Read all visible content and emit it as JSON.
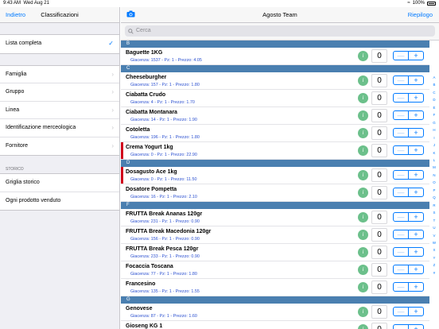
{
  "status": {
    "time": "9:43 AM",
    "date": "Wed Aug 21",
    "battery": "100%"
  },
  "left": {
    "back_label": "Indietro",
    "title": "Classificazioni",
    "complete_list": "Lista completa",
    "filters": [
      "Famiglia",
      "Gruppo",
      "Linea",
      "Identificazione merceologica",
      "Fornitore"
    ],
    "history_header": "STORICO",
    "history": [
      "Griglia storico",
      "Ogni prodotto venduto"
    ]
  },
  "main": {
    "title": "Agosto Team",
    "summary_label": "Riepilogo",
    "search_placeholder": "Cerca",
    "minus": "—",
    "plus": "+",
    "info": "i"
  },
  "sections": [
    {
      "letter": "B",
      "items": [
        {
          "name": "Baguette 1KG",
          "sub": "Giacenza: 1537 - Pz: 1 - Prezzo: 4.05",
          "qty": "0",
          "flag": false
        }
      ]
    },
    {
      "letter": "C",
      "items": [
        {
          "name": "Cheeseburgher",
          "sub": "Giacenza: 157 - Pz: 1 - Prezzo: 1.80",
          "qty": "0",
          "flag": false
        },
        {
          "name": "Ciabatta Crudo",
          "sub": "Giacenza: 4 - Pz: 1 - Prezzo: 1.70",
          "qty": "0",
          "flag": false
        },
        {
          "name": "Ciabatta Montanara",
          "sub": "Giacenza: 14 - Pz: 1 - Prezzo: 1.90",
          "qty": "0",
          "flag": false
        },
        {
          "name": "Cotoletta",
          "sub": "Giacenza: 196 - Pz: 1 - Prezzo: 1.80",
          "qty": "0",
          "flag": false
        },
        {
          "name": "Crema Yogurt 1kg",
          "sub": "Giacenza: 0 - Pz: 1 - Prezzo: 22.90",
          "qty": "0",
          "flag": true
        }
      ]
    },
    {
      "letter": "D",
      "items": [
        {
          "name": "Dosagusto Ace 1kg",
          "sub": "Giacenza: 0 - Pz: 1 - Prezzo: 11.50",
          "qty": "0",
          "flag": true
        },
        {
          "name": "Dosatore Pompetta",
          "sub": "Giacenza: 16 - Pz: 1 - Prezzo: 2.10",
          "qty": "0",
          "flag": false
        }
      ]
    },
    {
      "letter": "F",
      "items": [
        {
          "name": "FRUTTA Break Ananas 120gr",
          "sub": "Giacenza: 231 - Pz: 1 - Prezzo: 0.90",
          "qty": "0",
          "flag": false
        },
        {
          "name": "FRUTTA Break Macedonia 120gr",
          "sub": "Giacenza: 156 - Pz: 1 - Prezzo: 0.90",
          "qty": "0",
          "flag": false
        },
        {
          "name": "FRUTTA Break Pesca 120gr",
          "sub": "Giacenza: 233 - Pz: 1 - Prezzo: 0.90",
          "qty": "0",
          "flag": false
        },
        {
          "name": "Focaccia Toscana",
          "sub": "Giacenza: 77 - Pz: 1 - Prezzo: 1.80",
          "qty": "0",
          "flag": false
        },
        {
          "name": "Francesino",
          "sub": "Giacenza: 135 - Pz: 1 - Prezzo: 1.55",
          "qty": "0",
          "flag": false
        }
      ]
    },
    {
      "letter": "G",
      "items": [
        {
          "name": "Genovese",
          "sub": "Giacenza: 87 - Pz: 1 - Prezzo: 1.60",
          "qty": "0",
          "flag": false
        },
        {
          "name": "Gioseng KG 1",
          "sub": "",
          "qty": "0",
          "flag": false
        }
      ]
    }
  ],
  "index_letters": [
    "A",
    "B",
    "C",
    "D",
    "E",
    "F",
    "G",
    "H",
    "I",
    "J",
    "K",
    "L",
    "M",
    "N",
    "O",
    "P",
    "Q",
    "R",
    "S",
    "T",
    "U",
    "V",
    "W",
    "X",
    "Y",
    "Z",
    "#"
  ],
  "colors": {
    "accent": "#007aff",
    "section": "#4a7fb0",
    "info": "#6cc08b",
    "flag": "#d0021b"
  }
}
